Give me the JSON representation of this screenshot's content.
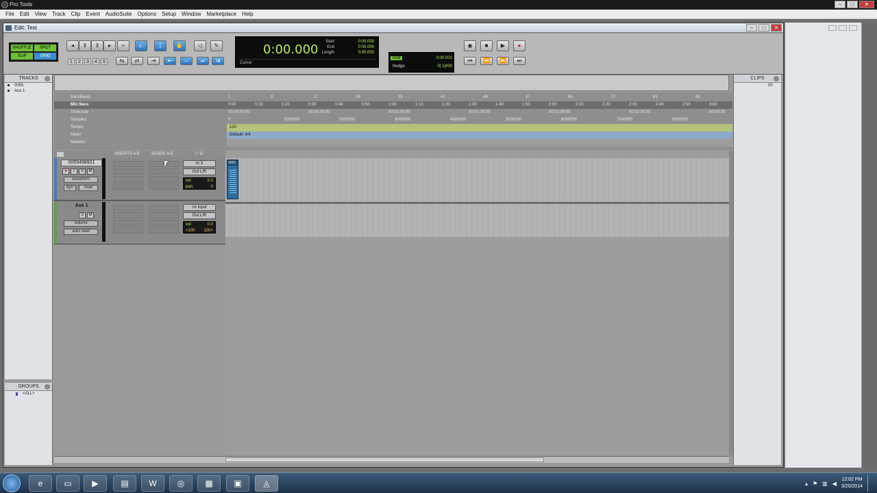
{
  "app": {
    "title": "Pro Tools"
  },
  "menu": [
    "File",
    "Edit",
    "View",
    "Track",
    "Clip",
    "Event",
    "AudioSuite",
    "Options",
    "Setup",
    "Window",
    "Marketplace",
    "Help"
  ],
  "edit_window": {
    "title": "Edit: Test"
  },
  "edit_modes": {
    "shuffle": "SHUFFLE",
    "spot": "SPOT",
    "slip": "SLIP",
    "grid": "GRID"
  },
  "zoom_presets": [
    "1",
    "2",
    "3",
    "4",
    "5"
  ],
  "counter": {
    "main": "0:00.000",
    "start_label": "Start",
    "end_label": "End",
    "length_label": "Length",
    "start": "0:00.000",
    "end": "0:00.000",
    "length": "0:00.000",
    "cursor_label": "Cursor"
  },
  "grid_nudge": {
    "grid_label": "Grid",
    "grid_value": "0:00.001",
    "nudge_label": "Nudge",
    "nudge_value": "0| 1|000"
  },
  "panels": {
    "tracks": "TRACKS",
    "groups": "GROUPS",
    "clips": "CLIPS"
  },
  "track_list": [
    "0055",
    "Aux 1"
  ],
  "group_list": [
    "<ALL>"
  ],
  "clip_list": [
    "00"
  ],
  "rulers": {
    "bars_beats": {
      "label": "Bars|Beats",
      "ticks": [
        "1",
        "9",
        "17",
        "25",
        "33",
        "41",
        "49",
        "57",
        "65",
        "73",
        "81",
        "89"
      ]
    },
    "min_secs": {
      "label": "Min:Secs",
      "ticks": [
        "0:00",
        "0:10",
        "0:20",
        "0:30",
        "0:40",
        "0:50",
        "1:00",
        "1:10",
        "1:20",
        "1:30",
        "1:40",
        "1:50",
        "2:00",
        "2:10",
        "2:20",
        "2:30",
        "2:40",
        "2:50",
        "3:00"
      ]
    },
    "timecode": {
      "label": "Timecode",
      "ticks": [
        "00:00:00:00",
        "00:00:30:00",
        "00:01:00:00",
        "00:01:30:00",
        "00:02:00:00",
        "00:02:30:00",
        "00:03:00"
      ]
    },
    "samples": {
      "label": "Samples",
      "ticks": [
        "0",
        "1000000",
        "2000000",
        "3000000",
        "4000000",
        "5000000",
        "6000000",
        "7000000",
        "8000000"
      ]
    },
    "tempo": {
      "label": "Tempo",
      "value": "120"
    },
    "meter": {
      "label": "Meter",
      "value": "Default: 4/4"
    },
    "markers": {
      "label": "Markers"
    }
  },
  "column_headers": {
    "inserts": "INSERTS A-E",
    "sends": "SENDS A-E",
    "io": "I / O"
  },
  "tracks": [
    {
      "name": "0055498921",
      "view": "waveform",
      "dyn": "dyn",
      "read": "read",
      "input": "In 3",
      "output": "Out L/R",
      "vol_label": "vol",
      "vol": "0.0",
      "pan_label": "pan",
      "pan": "0",
      "color": "#3c7fc2",
      "clip_name": "0055"
    },
    {
      "name": "Aux 1",
      "view": "volume",
      "auto": "auto read",
      "input": "no input",
      "output": "Out L/R",
      "vol_label": "vol",
      "vol": "0.0",
      "pan_l": "<100",
      "pan_r": "100>",
      "color": "#5aa63a"
    }
  ],
  "taskbar": {
    "time": "12:02 PM",
    "date": "3/20/2014"
  },
  "colors": {
    "counter_green": "#b8f04c",
    "mode_green": "#6fbf3a",
    "mode_blue": "#3e8fd0",
    "tempo_ruler": "#b5c27a",
    "meter_ruler": "#8fa9c8",
    "clip_blue": "#2e6e9e"
  }
}
